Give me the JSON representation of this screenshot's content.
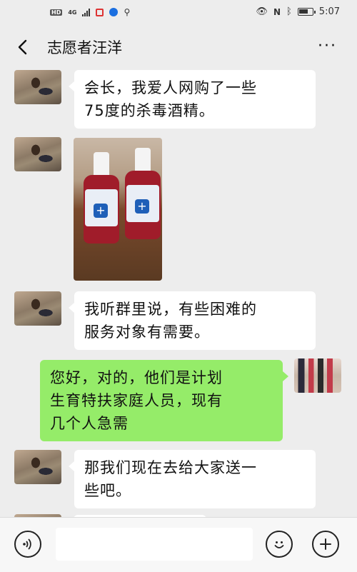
{
  "status_bar": {
    "left_badge": "HD",
    "network": "4G",
    "time": "5:07"
  },
  "header": {
    "title": "志愿者汪洋",
    "more": "···"
  },
  "messages": [
    {
      "side": "left",
      "type": "text",
      "text_lines": [
        "会长，我爱人网购了一些",
        "75度的杀毒酒精。"
      ]
    },
    {
      "side": "left",
      "type": "image",
      "icon": "alcohol-spray-bottles-photo"
    },
    {
      "side": "left",
      "type": "text",
      "text_lines": [
        "我听群里说，有些困难的",
        "服务对象有需要。"
      ]
    },
    {
      "side": "right",
      "type": "text",
      "text_lines": [
        "您好，对的，他们是计划",
        "生育特扶家庭人员，现有",
        "几个人急需"
      ]
    },
    {
      "side": "left",
      "type": "text",
      "text_lines": [
        "那我们现在去给大家送一",
        "些吧。"
      ]
    }
  ],
  "input_bar": {
    "placeholder": ""
  },
  "colors": {
    "background": "#ededed",
    "sent_bubble": "#95ec69",
    "received_bubble": "#ffffff"
  }
}
